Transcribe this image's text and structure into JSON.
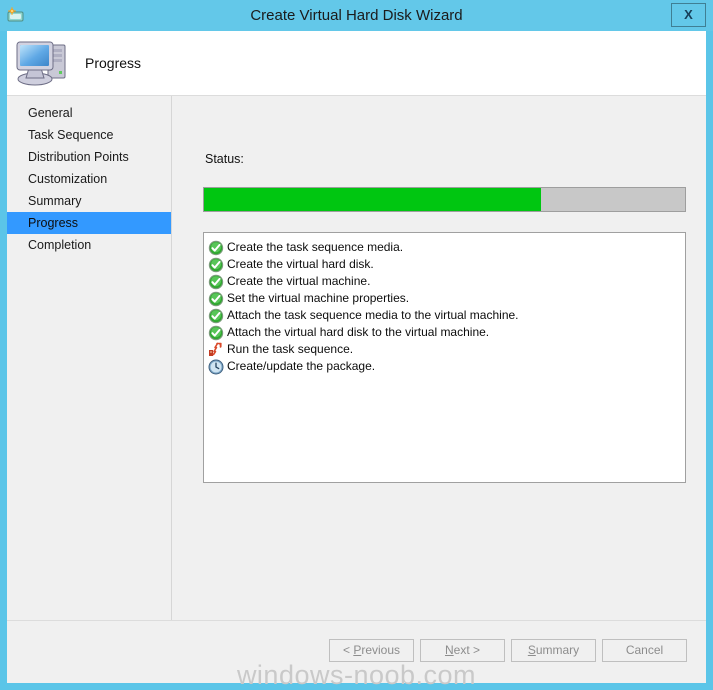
{
  "window": {
    "title": "Create Virtual Hard Disk Wizard",
    "titlebar_icon": "wizard-icon",
    "close_label": "X",
    "titlebar_color": "#63C8E9",
    "frame_color": "#5BC5E8"
  },
  "header": {
    "title": "Progress",
    "icon": "computer-icon"
  },
  "sidebar": {
    "items": [
      {
        "label": "General",
        "selected": false
      },
      {
        "label": "Task Sequence",
        "selected": false
      },
      {
        "label": "Distribution Points",
        "selected": false
      },
      {
        "label": "Customization",
        "selected": false
      },
      {
        "label": "Summary",
        "selected": false
      },
      {
        "label": "Progress",
        "selected": true
      },
      {
        "label": "Completion",
        "selected": false
      }
    ],
    "selected_color": "#3399FF"
  },
  "content": {
    "status_label": "Status:",
    "progress": {
      "percent": 70,
      "fill_color": "#00C611",
      "track_color": "#C8C8C8"
    },
    "tasks": [
      {
        "icon": "green-check-icon",
        "label": "Create the task sequence media."
      },
      {
        "icon": "green-check-icon",
        "label": "Create the virtual hard disk."
      },
      {
        "icon": "green-check-icon",
        "label": "Create the virtual machine."
      },
      {
        "icon": "green-check-icon",
        "label": "Set the virtual machine properties."
      },
      {
        "icon": "green-check-icon",
        "label": "Attach the task sequence media to the virtual machine."
      },
      {
        "icon": "green-check-icon",
        "label": "Attach the virtual hard disk to the virtual machine."
      },
      {
        "icon": "running-task-icon",
        "label": "Run the task sequence."
      },
      {
        "icon": "clock-pending-icon",
        "label": "Create/update the package."
      }
    ]
  },
  "footer": {
    "buttons": [
      {
        "name": "previous",
        "prefix": "< ",
        "accel": "P",
        "suffix": "revious",
        "disabled": true
      },
      {
        "name": "next",
        "prefix": "",
        "accel": "N",
        "suffix": "ext >",
        "disabled": true
      },
      {
        "name": "summary",
        "prefix": "",
        "accel": "S",
        "suffix": "ummary",
        "disabled": true
      },
      {
        "name": "cancel",
        "prefix": "",
        "accel": "",
        "suffix": "Cancel",
        "disabled": true
      }
    ]
  },
  "watermark": {
    "text": "windows-noob.com"
  }
}
